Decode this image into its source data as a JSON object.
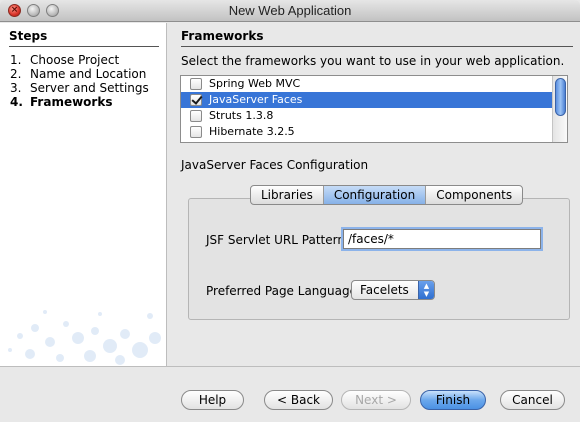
{
  "window": {
    "title": "New Web Application"
  },
  "steps": {
    "header": "Steps",
    "items": [
      {
        "num": "1.",
        "label": "Choose Project"
      },
      {
        "num": "2.",
        "label": "Name and Location"
      },
      {
        "num": "3.",
        "label": "Server and Settings"
      },
      {
        "num": "4.",
        "label": "Frameworks"
      }
    ],
    "current_index": 3
  },
  "main": {
    "header": "Frameworks",
    "instruction": "Select the frameworks you want to use in your web application.",
    "frameworks": [
      {
        "label": "Spring Web MVC",
        "checked": false,
        "selected": false
      },
      {
        "label": "JavaServer Faces",
        "checked": true,
        "selected": true
      },
      {
        "label": "Struts 1.3.8",
        "checked": false,
        "selected": false
      },
      {
        "label": "Hibernate 3.2.5",
        "checked": false,
        "selected": false
      }
    ],
    "config_title": "JavaServer Faces Configuration",
    "tabs": [
      {
        "label": "Libraries",
        "active": false
      },
      {
        "label": "Configuration",
        "active": true
      },
      {
        "label": "Components",
        "active": false
      }
    ],
    "servlet_label": "JSF Servlet URL Pattern:",
    "servlet_value": "/faces/*",
    "language_label": "Preferred Page Language:",
    "language_value": "Facelets"
  },
  "buttons": {
    "help": "Help",
    "back": "< Back",
    "next": "Next >",
    "finish": "Finish",
    "cancel": "Cancel"
  },
  "colors": {
    "selection": "#3875d7",
    "default_button": "#4b91e4"
  }
}
